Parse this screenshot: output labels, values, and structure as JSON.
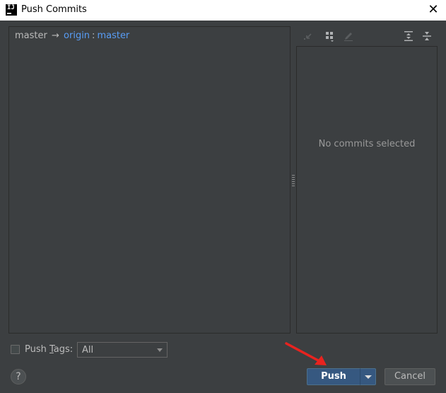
{
  "window": {
    "title": "Push Commits",
    "app_icon_text": "IJ",
    "close_glyph": "✕"
  },
  "branch_row": {
    "local_branch": "master",
    "arrow": "→",
    "remote": "origin",
    "separator": ":",
    "remote_branch": "master"
  },
  "details": {
    "empty_message": "No commits selected"
  },
  "toolbar": {
    "icons": [
      "cherry-pick-icon",
      "group-by-icon",
      "edit-icon",
      "expand-all-icon",
      "collapse-all-icon"
    ]
  },
  "options": {
    "push_tags_label_prefix": "Push ",
    "push_tags_label_mnemonic": "T",
    "push_tags_label_suffix": "ags:",
    "push_tags_checked": false,
    "tags_select_value": "All"
  },
  "footer": {
    "help_label": "?",
    "push_label": "Push",
    "cancel_label": "Cancel"
  },
  "colors": {
    "background": "#3c3f41",
    "link": "#589df6",
    "primary_button": "#365880",
    "annotation_arrow": "#e8231f"
  }
}
